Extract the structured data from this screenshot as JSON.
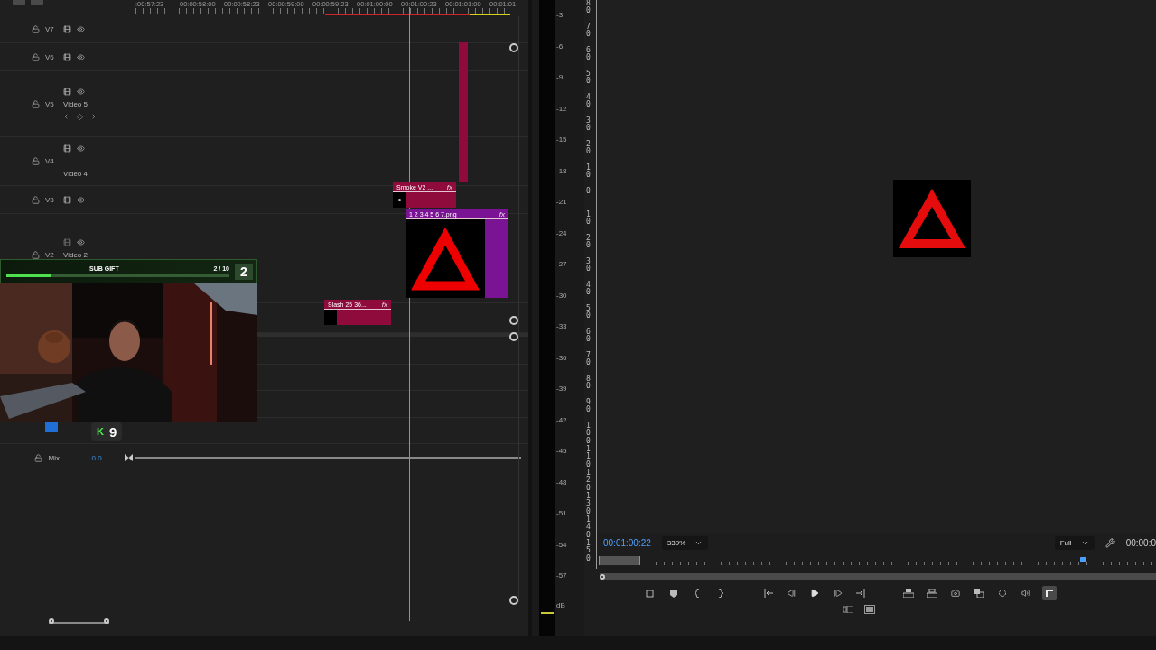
{
  "timeline": {
    "ruler_labels": [
      ":00:57:23",
      "00:00:58:00",
      "00:00:58:23",
      "00:00:59:00",
      "00:00:59:23",
      "00:01:00:00",
      "00:01:00:23",
      "00:01:01:00",
      "00:01:01"
    ],
    "video_tracks": [
      {
        "label": "V7",
        "output_enabled": true
      },
      {
        "label": "V6",
        "output_enabled": true
      },
      {
        "label": "V5",
        "name": "Video 5",
        "keyframes": true,
        "output_enabled": true
      },
      {
        "label": "V4",
        "name": "Video 4",
        "output_enabled": true
      },
      {
        "label": "V3",
        "output_enabled": true
      },
      {
        "label": "V2",
        "name": "Video 2",
        "output_enabled": false
      }
    ],
    "clips": [
      {
        "kind": "bar",
        "color": "#8e0b3c"
      },
      {
        "kind": "titled",
        "label": "Smoke V2 ...",
        "effect": "fx",
        "color": "#8e0b3c"
      },
      {
        "label": "1 2 3 4 5 6 7.png",
        "effect": "fx",
        "color": "#7a1494"
      },
      {
        "kind": "titled",
        "label": "Slash 25 36...",
        "effect": "fx",
        "color": "#8e0b3c"
      }
    ],
    "mix": {
      "label": "Mix",
      "value": "0.0"
    }
  },
  "overlay": {
    "title": "SUB GIFT",
    "count": "2 / 10",
    "badge": "2",
    "level": 0.2,
    "tag_letter": "K",
    "tag_number": "9"
  },
  "meter": {
    "scale": [
      "-3",
      "-6",
      "-9",
      "-12",
      "-15",
      "-18",
      "-21",
      "-24",
      "-27",
      "-30",
      "-33",
      "-36",
      "-39",
      "-42",
      "-45",
      "-48",
      "-51",
      "-54",
      "-57"
    ],
    "unit": "dB"
  },
  "vertical_ruler": [
    "80",
    "70",
    "60",
    "50",
    "40",
    "30",
    "20",
    "10",
    "0",
    "10",
    "20",
    "30",
    "40",
    "50",
    "60",
    "70",
    "80",
    "90",
    "100",
    "110",
    "120",
    "130",
    "140",
    "150"
  ],
  "program": {
    "timecode": "00:01:00:22",
    "zoom": "339%",
    "quality": "Full",
    "duration": "00:00:0"
  }
}
